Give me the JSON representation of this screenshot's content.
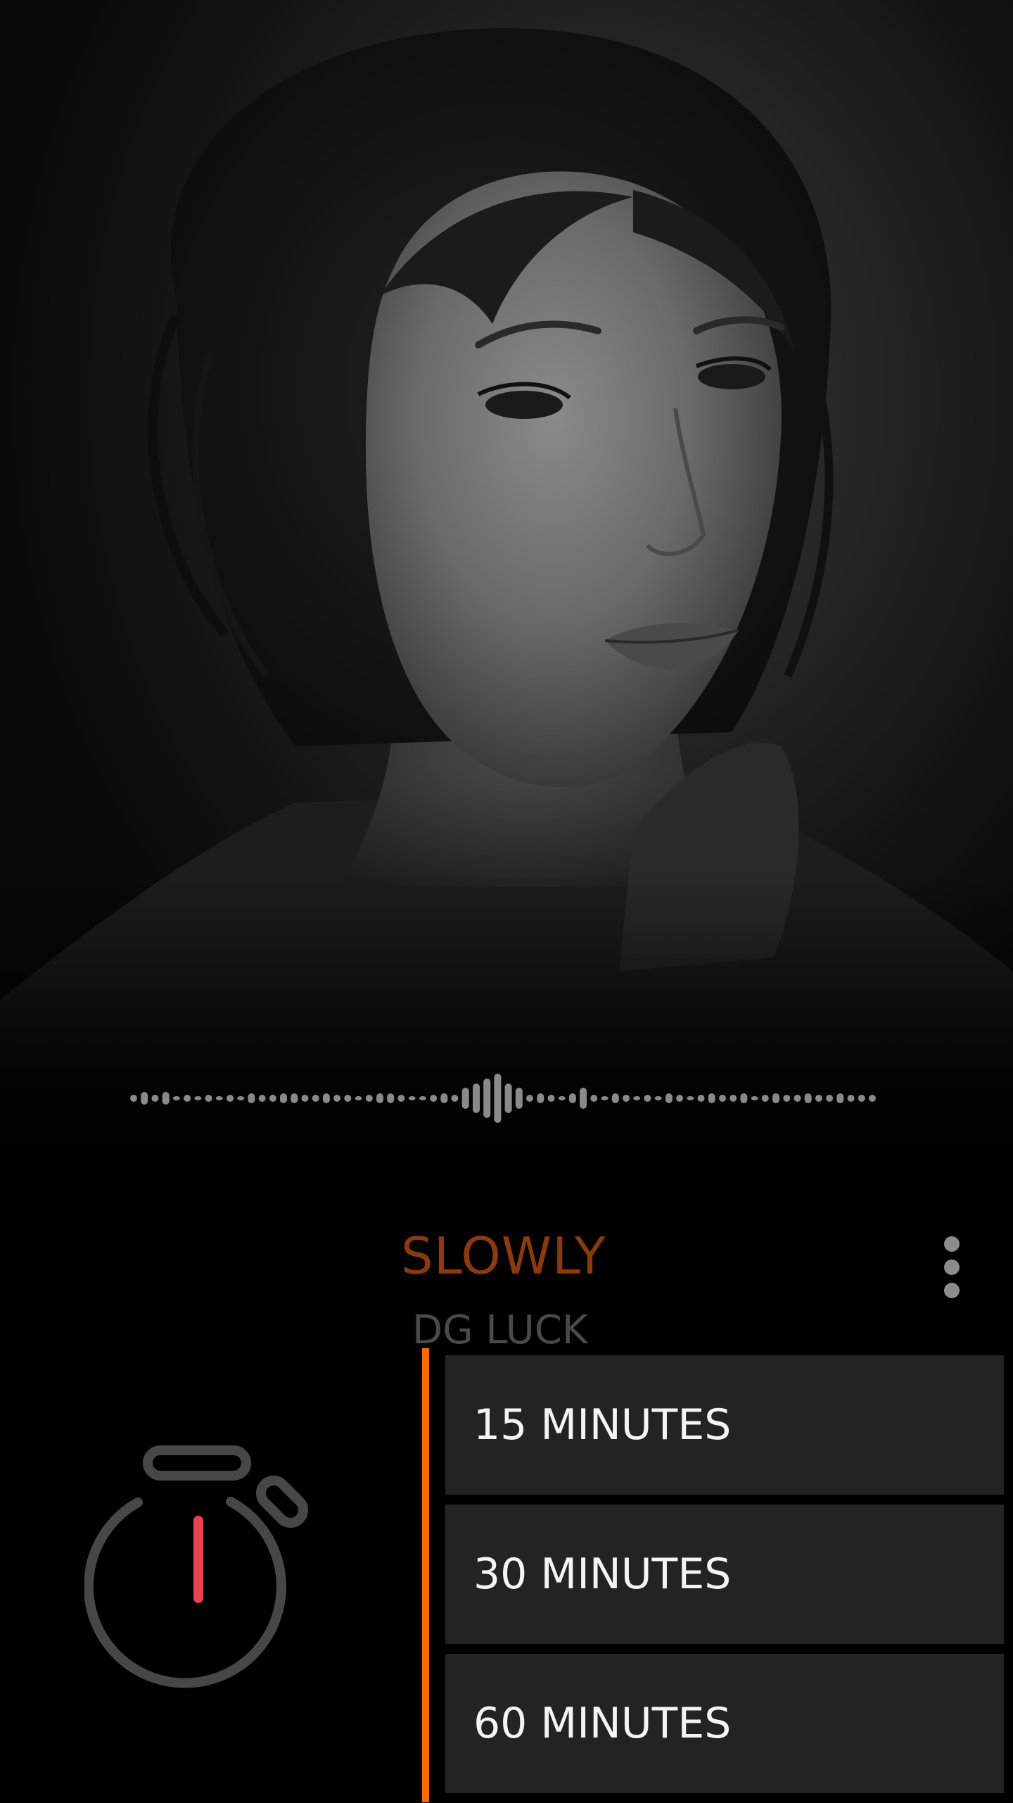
{
  "album": {
    "image_semantic": "black-and-white portrait of a woman"
  },
  "track": {
    "title": "SLOWLY",
    "artist": "DG LUCK"
  },
  "menu": {
    "icon": "more-vertical-icon"
  },
  "timer": {
    "icon": "stopwatch-icon",
    "options": [
      {
        "label": "15 MINUTES"
      },
      {
        "label": "30 MINUTES"
      },
      {
        "label": "60 MINUTES"
      }
    ]
  },
  "colors": {
    "accent": "#ff6a00",
    "title": "#8a3a0c",
    "artist": "#4a4a4a",
    "stopwatch_hand": "#e8424d",
    "stopwatch_body": "#474747",
    "option_bg": "#232323",
    "waveform": "#8a8a8a"
  }
}
